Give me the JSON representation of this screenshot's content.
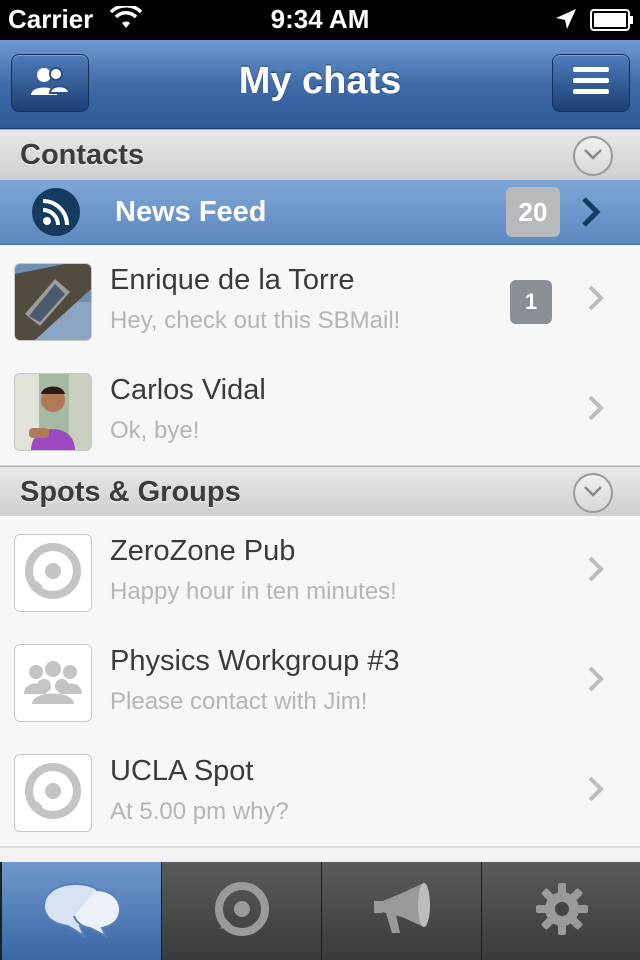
{
  "status_bar": {
    "carrier": "Carrier",
    "time": "9:34 AM"
  },
  "nav": {
    "title": "My chats",
    "left_icon": "contacts-icon",
    "right_icon": "menu-icon"
  },
  "contacts_section": {
    "title": "Contacts"
  },
  "news_feed": {
    "label": "News Feed",
    "badge": "20",
    "icon": "rss-icon"
  },
  "contacts": [
    {
      "name": "Enrique de la Torre",
      "message": "Hey, check out this SBMail!",
      "badge": "1"
    },
    {
      "name": "Carlos Vidal",
      "message": "Ok, bye!"
    }
  ],
  "spots_section": {
    "title": "Spots & Groups"
  },
  "spots": [
    {
      "name": "ZeroZone Pub",
      "message": "Happy hour in ten minutes!",
      "icon": "spot-icon"
    },
    {
      "name": "Physics Workgroup #3",
      "message": "Please contact with Jim!",
      "icon": "group-icon"
    },
    {
      "name": "UCLA Spot",
      "message": "At 5.00 pm why?",
      "icon": "spot-icon"
    }
  ],
  "tabs": [
    {
      "icon": "chats-icon",
      "active": true
    },
    {
      "icon": "spot-icon",
      "active": false
    },
    {
      "icon": "megaphone-icon",
      "active": false
    },
    {
      "icon": "gear-icon",
      "active": false
    }
  ],
  "colors": {
    "nav_blue": "#3f6ba9",
    "news_feed_blue": "#6f98cc",
    "badge_gray": "#8a8f96"
  }
}
